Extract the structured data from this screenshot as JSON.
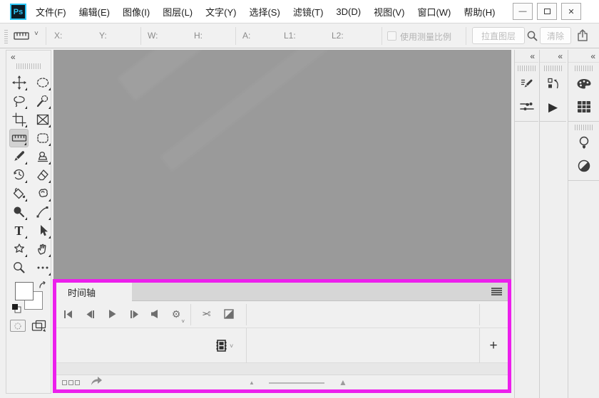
{
  "app": {
    "name": "Adobe Photoshop",
    "logo": "Ps"
  },
  "menu": {
    "items": [
      "文件(F)",
      "编辑(E)",
      "图像(I)",
      "图层(L)",
      "文字(Y)",
      "选择(S)",
      "滤镜(T)",
      "3D(D)",
      "视图(V)",
      "窗口(W)",
      "帮助(H)"
    ]
  },
  "window_controls": {
    "minimize": "—",
    "close": "✕"
  },
  "options": {
    "tool": "ruler-tool-preset",
    "fields": [
      "X:",
      "Y:",
      "W:",
      "H:",
      "A:",
      "L1:",
      "L2:"
    ],
    "values": [
      "",
      "",
      "",
      "",
      "",
      "",
      ""
    ],
    "use_measurement_scale_label": "使用测量比例",
    "use_measurement_scale_checked": false,
    "straighten_layer_button": "拉直图层",
    "clear_button": "清除"
  },
  "toolbar": {
    "selected_tool": "ruler",
    "tools": [
      "move",
      "elliptical-marquee",
      "lasso",
      "quick-selection",
      "crop",
      "frame",
      "ruler",
      "patch",
      "brush",
      "clone-stamp",
      "history-brush",
      "eraser",
      "paint-bucket",
      "smudge",
      "dodge",
      "pen",
      "type",
      "path-selection",
      "custom-shape",
      "hand",
      "zoom",
      "more-tools"
    ]
  },
  "right_panels": {
    "columns": [
      {
        "icons": [
          "brush-settings",
          "brushes"
        ]
      },
      {
        "icons": [
          "history",
          "actions"
        ]
      },
      {
        "icons": [
          "color",
          "swatches",
          "learn",
          "adjustments"
        ]
      }
    ]
  },
  "timeline": {
    "tab": "时间轴",
    "transport": [
      "go-to-first-frame",
      "go-to-previous-frame",
      "play",
      "go-to-next-frame",
      "mute-audio",
      "timeline-settings"
    ],
    "edit_tools": [
      "split-at-playhead",
      "transition"
    ],
    "track_selector": "video-track-menu",
    "add_media_button": "+",
    "bottom_tools": [
      "convert-to-frame-animation",
      "render-video-shortcut",
      "zoom-out",
      "zoom-slider",
      "zoom-in"
    ]
  },
  "icons": {
    "gear": "⚙",
    "scissors": "✂",
    "play": "▶",
    "chevron-down": "˅",
    "collapse": "«",
    "triangle-small": "▲",
    "triangle-large": "▲"
  },
  "colors": {
    "highlight_border": "#ec1fec",
    "canvas_gray": "#9a9a9a",
    "logo_accent": "#2fc7f7",
    "chrome": "#f0f0f0"
  }
}
